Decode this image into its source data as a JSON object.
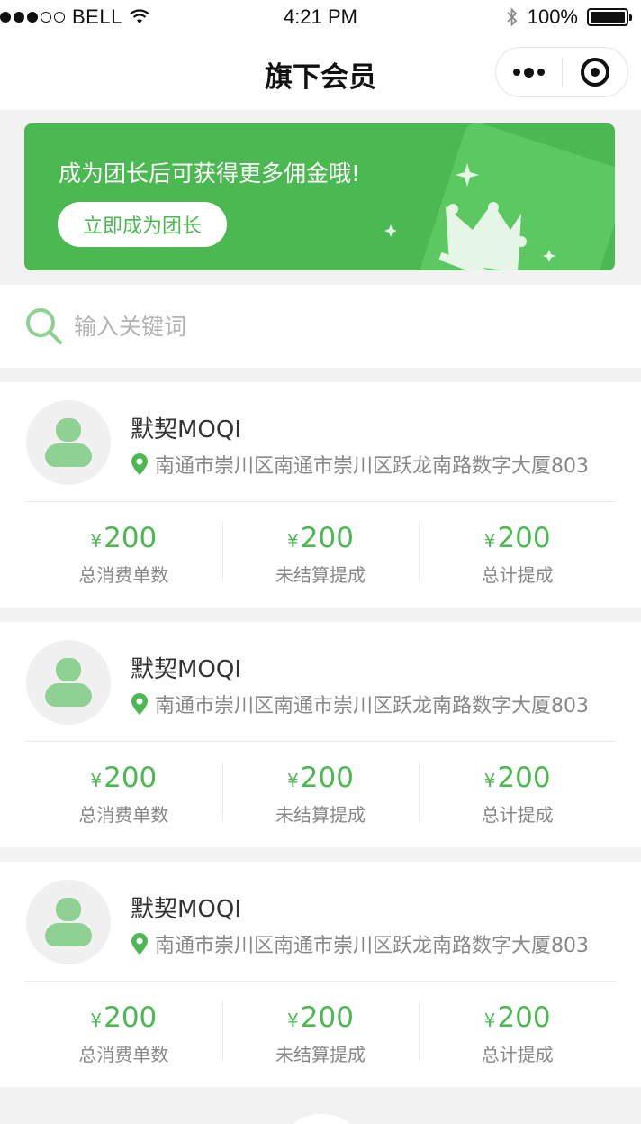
{
  "status_bar": {
    "carrier": "BELL",
    "time": "4:21 PM",
    "battery": "100%"
  },
  "nav": {
    "title": "旗下会员"
  },
  "banner": {
    "text": "成为团长后可获得更多佣金哦!",
    "button_label": "立即成为团长"
  },
  "search": {
    "placeholder": "输入关键词"
  },
  "members": [
    {
      "name": "默契MOQI",
      "address": "南通市崇川区南通市崇川区跃龙南路数字大厦803",
      "stats": [
        {
          "currency": "¥",
          "value": "200",
          "label": "总消费单数"
        },
        {
          "currency": "¥",
          "value": "200",
          "label": "未结算提成"
        },
        {
          "currency": "¥",
          "value": "200",
          "label": "总计提成"
        }
      ]
    },
    {
      "name": "默契MOQI",
      "address": "南通市崇川区南通市崇川区跃龙南路数字大厦803",
      "stats": [
        {
          "currency": "¥",
          "value": "200",
          "label": "总消费单数"
        },
        {
          "currency": "¥",
          "value": "200",
          "label": "未结算提成"
        },
        {
          "currency": "¥",
          "value": "200",
          "label": "总计提成"
        }
      ]
    },
    {
      "name": "默契MOQI",
      "address": "南通市崇川区南通市崇川区跃龙南路数字大厦803",
      "stats": [
        {
          "currency": "¥",
          "value": "200",
          "label": "总消费单数"
        },
        {
          "currency": "¥",
          "value": "200",
          "label": "未结算提成"
        },
        {
          "currency": "¥",
          "value": "200",
          "label": "总计提成"
        }
      ]
    }
  ],
  "colors": {
    "accent": "#4cb851",
    "background": "#f2f2f2"
  },
  "icons": {
    "search": "search-icon",
    "location": "location-pin-icon",
    "avatar": "user-avatar-icon",
    "more": "more-dots-icon",
    "close": "close-target-icon"
  }
}
